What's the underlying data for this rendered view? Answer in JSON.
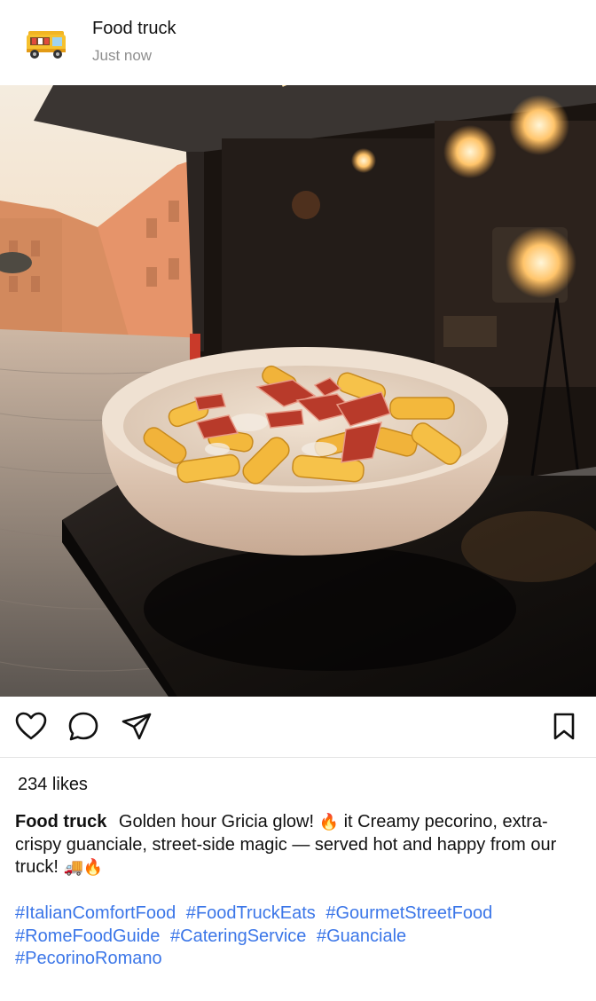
{
  "post": {
    "account": "Food truck",
    "time": "Just now"
  },
  "icons": {
    "avatar": "food-truck-avatar",
    "like": "heart-icon",
    "comment": "comment-bubble-icon",
    "share": "paper-plane-icon",
    "save": "bookmark-icon"
  },
  "engagement": {
    "likes": "234 likes"
  },
  "caption": {
    "user": "Food truck",
    "text_part1": "Golden hour Gricia glow!",
    "emoji_fire": "🔥",
    "text_part2": "it Creamy pecorino, extra-crispy guanciale, street-side magic — served hot and happy from our truck!",
    "emoji_truck": "🚚",
    "hashtags": [
      "#ItalianComfortFood",
      "#FoodTruckEats",
      "#GourmetStreetFood",
      "#RomeFoodGuide",
      "#CateringService",
      "#Guanciale",
      "#PecorinoRomano"
    ]
  },
  "colors": {
    "hashtag": "#3b76e8",
    "meta": "#8e8e8e"
  }
}
